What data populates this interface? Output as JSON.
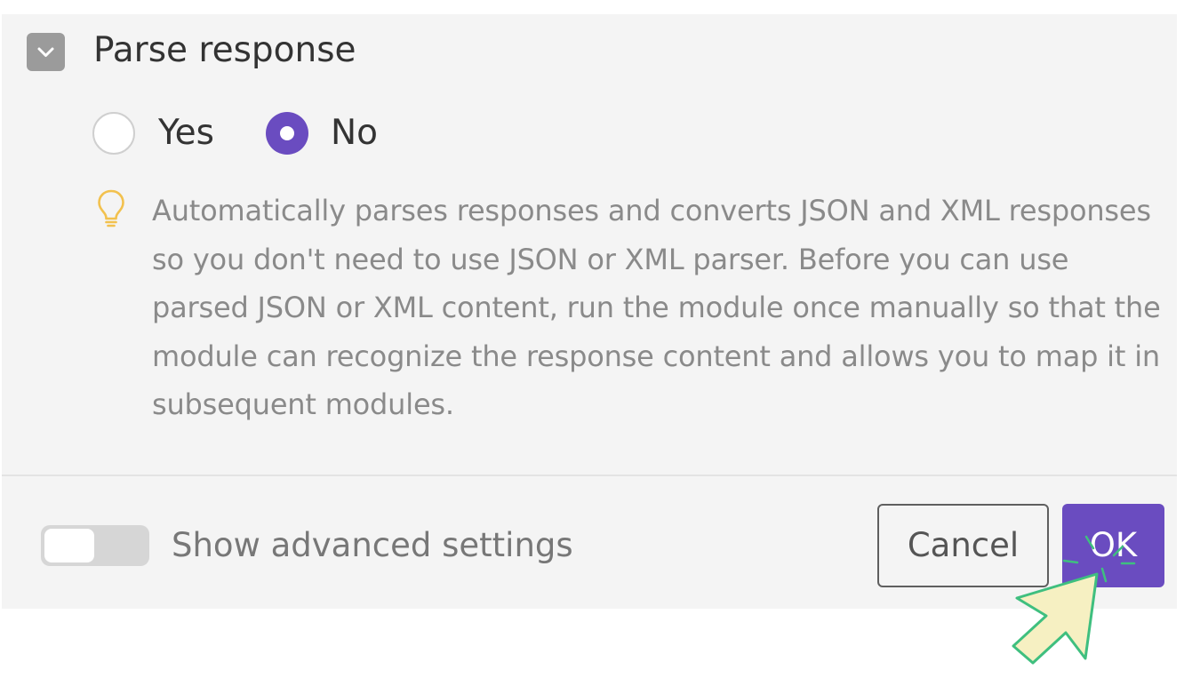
{
  "section": {
    "title": "Parse response",
    "collapse_icon": "chevron-down-icon",
    "options": [
      {
        "label": "Yes",
        "selected": false
      },
      {
        "label": "No",
        "selected": true
      }
    ],
    "help_icon": "lightbulb-icon",
    "help_text": "Automatically parses responses and converts JSON and XML responses so you don't need to use JSON or XML parser. Before you can use parsed JSON or XML content, run the module once manually so that the module can recognize the response content and allows you to map it in subsequent modules."
  },
  "footer": {
    "advanced_toggle": {
      "label": "Show advanced settings",
      "on": false
    },
    "cancel_label": "Cancel",
    "ok_label": "OK"
  },
  "colors": {
    "accent": "#6a4cc0",
    "panel_bg": "#f4f4f4",
    "hint_icon": "#f2c14e",
    "cursor_fill": "#f6f0c2",
    "cursor_stroke": "#3fbf7f"
  }
}
